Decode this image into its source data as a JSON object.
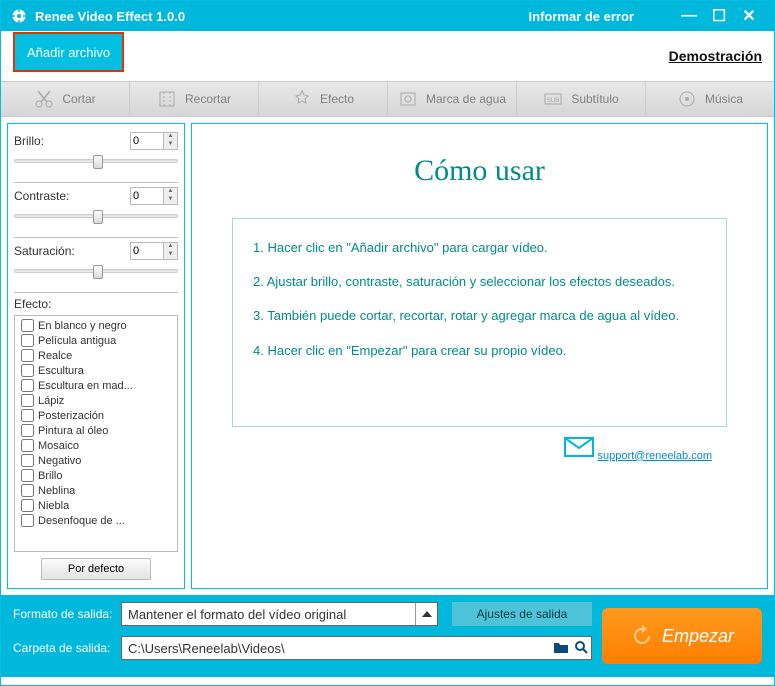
{
  "titlebar": {
    "app_name": "Renee Video Effect 1.0.0",
    "report_error": "Informar de error"
  },
  "topbar": {
    "add_file": "Añadir archivo",
    "demo": "Demostración"
  },
  "tabs": {
    "cortar": "Cortar",
    "recortar": "Recortar",
    "efecto": "Efecto",
    "marca": "Marca de agua",
    "subtitulo": "Subtítulo",
    "musica": "Música"
  },
  "sidebar": {
    "brillo_label": "Brillo:",
    "brillo_value": "0",
    "contraste_label": "Contraste:",
    "contraste_value": "0",
    "saturacion_label": "Saturación:",
    "saturacion_value": "0",
    "efecto_label": "Efecto:",
    "effects": [
      "En blanco y negro",
      "Película antigua",
      "Realce",
      "Escultura",
      "Escultura en mad...",
      "Lápiz",
      "Posterización",
      "Pintura al óleo",
      "Mosaico",
      "Negativo",
      "Brillo",
      "Neblina",
      "Niebla",
      "Desenfoque de ..."
    ],
    "default_btn": "Por defecto"
  },
  "main": {
    "title": "Cómo usar",
    "step1": "1. Hacer clic en \"Añadir archivo\" para cargar vídeo.",
    "step2": "2. Ajustar brillo, contraste, saturación y seleccionar los efectos deseados.",
    "step3": "3. También puede cortar, recortar, rotar y agregar marca de agua al vídeo.",
    "step4": "4. Hacer clic en \"Empezar\" para crear su propio vídeo.",
    "support_email": "support@reneelab.com"
  },
  "bottom": {
    "formato_label": "Formato de salida:",
    "formato_value": "Mantener el formato del vídeo original",
    "ajustes_btn": "Ajustes de salida",
    "carpeta_label": "Carpeta de salida:",
    "carpeta_value": "C:\\Users\\Reneelab\\Videos\\",
    "start_btn": "Empezar"
  }
}
